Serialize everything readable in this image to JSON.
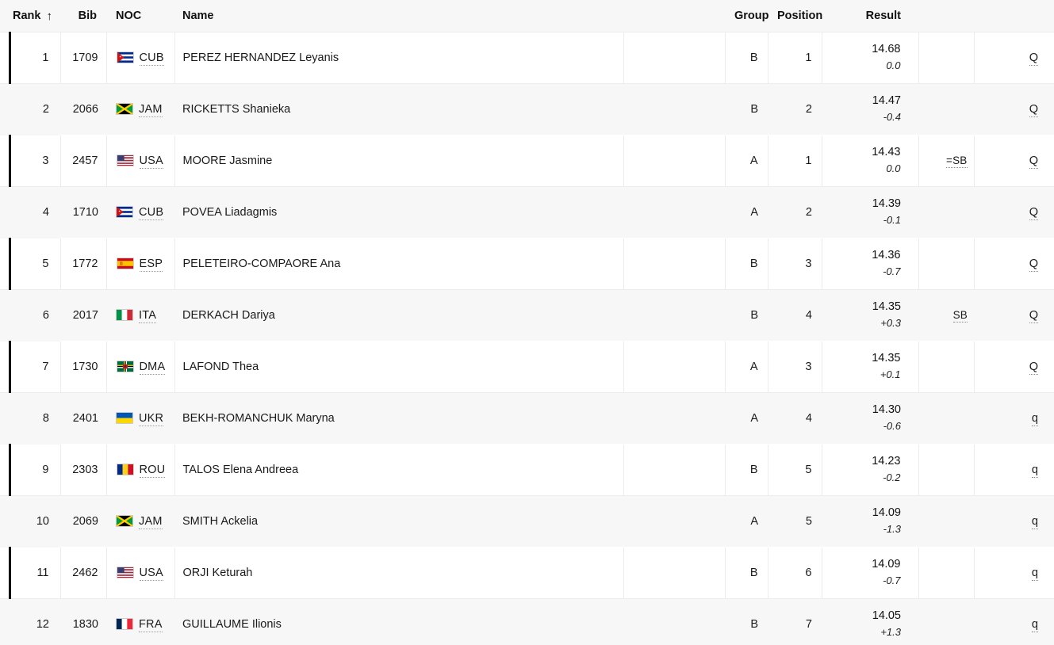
{
  "table": {
    "headers": {
      "rank": "Rank",
      "sort_arrow": "↑",
      "bib": "Bib",
      "noc": "NOC",
      "name": "Name",
      "spacer": "",
      "group": "Group",
      "position": "Position",
      "result": "Result",
      "mark": "",
      "qualification": ""
    },
    "rows": [
      {
        "rank": "1",
        "bib": "1709",
        "noc": "CUB",
        "flag": "flag-cub",
        "name": "PEREZ HERNANDEZ Leyanis",
        "group": "B",
        "position": "1",
        "result": "14.68",
        "wind": "0.0",
        "mark": "",
        "qualification": "Q"
      },
      {
        "rank": "2",
        "bib": "2066",
        "noc": "JAM",
        "flag": "flag-jam",
        "name": "RICKETTS Shanieka",
        "group": "B",
        "position": "2",
        "result": "14.47",
        "wind": "-0.4",
        "mark": "",
        "qualification": "Q"
      },
      {
        "rank": "3",
        "bib": "2457",
        "noc": "USA",
        "flag": "flag-usa",
        "name": "MOORE Jasmine",
        "group": "A",
        "position": "1",
        "result": "14.43",
        "wind": "0.0",
        "mark": "=SB",
        "qualification": "Q"
      },
      {
        "rank": "4",
        "bib": "1710",
        "noc": "CUB",
        "flag": "flag-cub",
        "name": "POVEA Liadagmis",
        "group": "A",
        "position": "2",
        "result": "14.39",
        "wind": "-0.1",
        "mark": "",
        "qualification": "Q"
      },
      {
        "rank": "5",
        "bib": "1772",
        "noc": "ESP",
        "flag": "flag-esp",
        "name": "PELETEIRO-COMPAORE Ana",
        "group": "B",
        "position": "3",
        "result": "14.36",
        "wind": "-0.7",
        "mark": "",
        "qualification": "Q"
      },
      {
        "rank": "6",
        "bib": "2017",
        "noc": "ITA",
        "flag": "flag-ita",
        "name": "DERKACH Dariya",
        "group": "B",
        "position": "4",
        "result": "14.35",
        "wind": "+0.3",
        "mark": "SB",
        "qualification": "Q"
      },
      {
        "rank": "7",
        "bib": "1730",
        "noc": "DMA",
        "flag": "flag-dma",
        "name": "LAFOND Thea",
        "group": "A",
        "position": "3",
        "result": "14.35",
        "wind": "+0.1",
        "mark": "",
        "qualification": "Q"
      },
      {
        "rank": "8",
        "bib": "2401",
        "noc": "UKR",
        "flag": "flag-ukr",
        "name": "BEKH-ROMANCHUK Maryna",
        "group": "A",
        "position": "4",
        "result": "14.30",
        "wind": "-0.6",
        "mark": "",
        "qualification": "q"
      },
      {
        "rank": "9",
        "bib": "2303",
        "noc": "ROU",
        "flag": "flag-rou",
        "name": "TALOS Elena Andreea",
        "group": "B",
        "position": "5",
        "result": "14.23",
        "wind": "-0.2",
        "mark": "",
        "qualification": "q"
      },
      {
        "rank": "10",
        "bib": "2069",
        "noc": "JAM",
        "flag": "flag-jam",
        "name": "SMITH Ackelia",
        "group": "A",
        "position": "5",
        "result": "14.09",
        "wind": "-1.3",
        "mark": "",
        "qualification": "q"
      },
      {
        "rank": "11",
        "bib": "2462",
        "noc": "USA",
        "flag": "flag-usa",
        "name": "ORJI Keturah",
        "group": "B",
        "position": "6",
        "result": "14.09",
        "wind": "-0.7",
        "mark": "",
        "qualification": "q"
      },
      {
        "rank": "12",
        "bib": "1830",
        "noc": "FRA",
        "flag": "flag-fra",
        "name": "GUILLAUME Ilionis",
        "group": "B",
        "position": "7",
        "result": "14.05",
        "wind": "+1.3",
        "mark": "",
        "qualification": "q"
      }
    ]
  },
  "colors": {
    "row_odd_bg": "#ffffff",
    "row_even_bg": "#f7f7f7",
    "accent_bar": "#111111",
    "border": "#ececec",
    "text": "#1a1a1a"
  }
}
